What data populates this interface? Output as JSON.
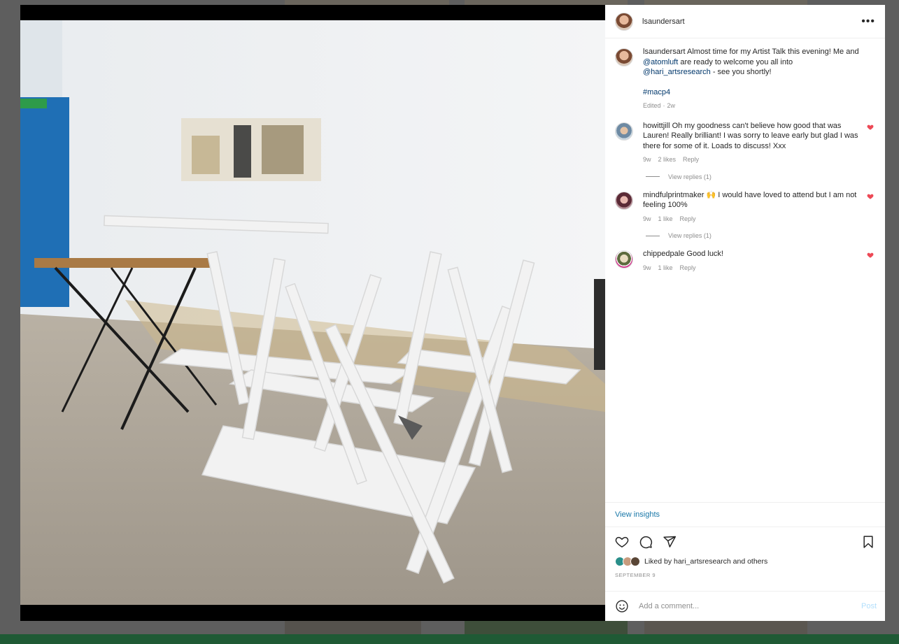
{
  "post": {
    "username": "lsaundersart",
    "caption": {
      "username": "lsaundersart",
      "text_1": "Almost time for my Artist Talk this evening! Me and ",
      "mention_1": "@atomluft",
      "text_2": " are ready to welcome you all into ",
      "mention_2": "@hari_artsresearch",
      "text_3": " - see you shortly!",
      "hashtag": "#macp4",
      "edited": "Edited",
      "age": "2w"
    },
    "comments": [
      {
        "username": "howittjill",
        "text": "Oh my goodness can't believe how good that was Lauren! Really brilliant! I was sorry to leave early but glad I was there for some of it. Loads to discuss! Xxx",
        "age": "9w",
        "likes": "2 likes",
        "reply": "Reply",
        "view_replies": "View replies (1)"
      },
      {
        "username": "mindfulprintmaker",
        "text": "🙌 I would have loved to attend but I am not feeling 100%",
        "age": "9w",
        "likes": "1 like",
        "reply": "Reply",
        "view_replies": "View replies (1)"
      },
      {
        "username": "chippedpale",
        "text": "Good luck!",
        "age": "9w",
        "likes": "1 like",
        "reply": "Reply"
      }
    ],
    "insights_label": "View insights",
    "liked_by_text": "Liked by hari_artsresearch and others",
    "date": "SEPTEMBER 9",
    "comment_placeholder": "Add a comment...",
    "post_label": "Post",
    "more_label": "•••",
    "icons": [
      "heart-icon",
      "comment-icon",
      "share-icon",
      "bookmark-icon",
      "emoji-icon",
      "more-icon"
    ],
    "colors": {
      "link": "#00376b",
      "insights": "#1877a8",
      "like_red": "#ed4956",
      "post_disabled": "#b2dffc"
    }
  }
}
